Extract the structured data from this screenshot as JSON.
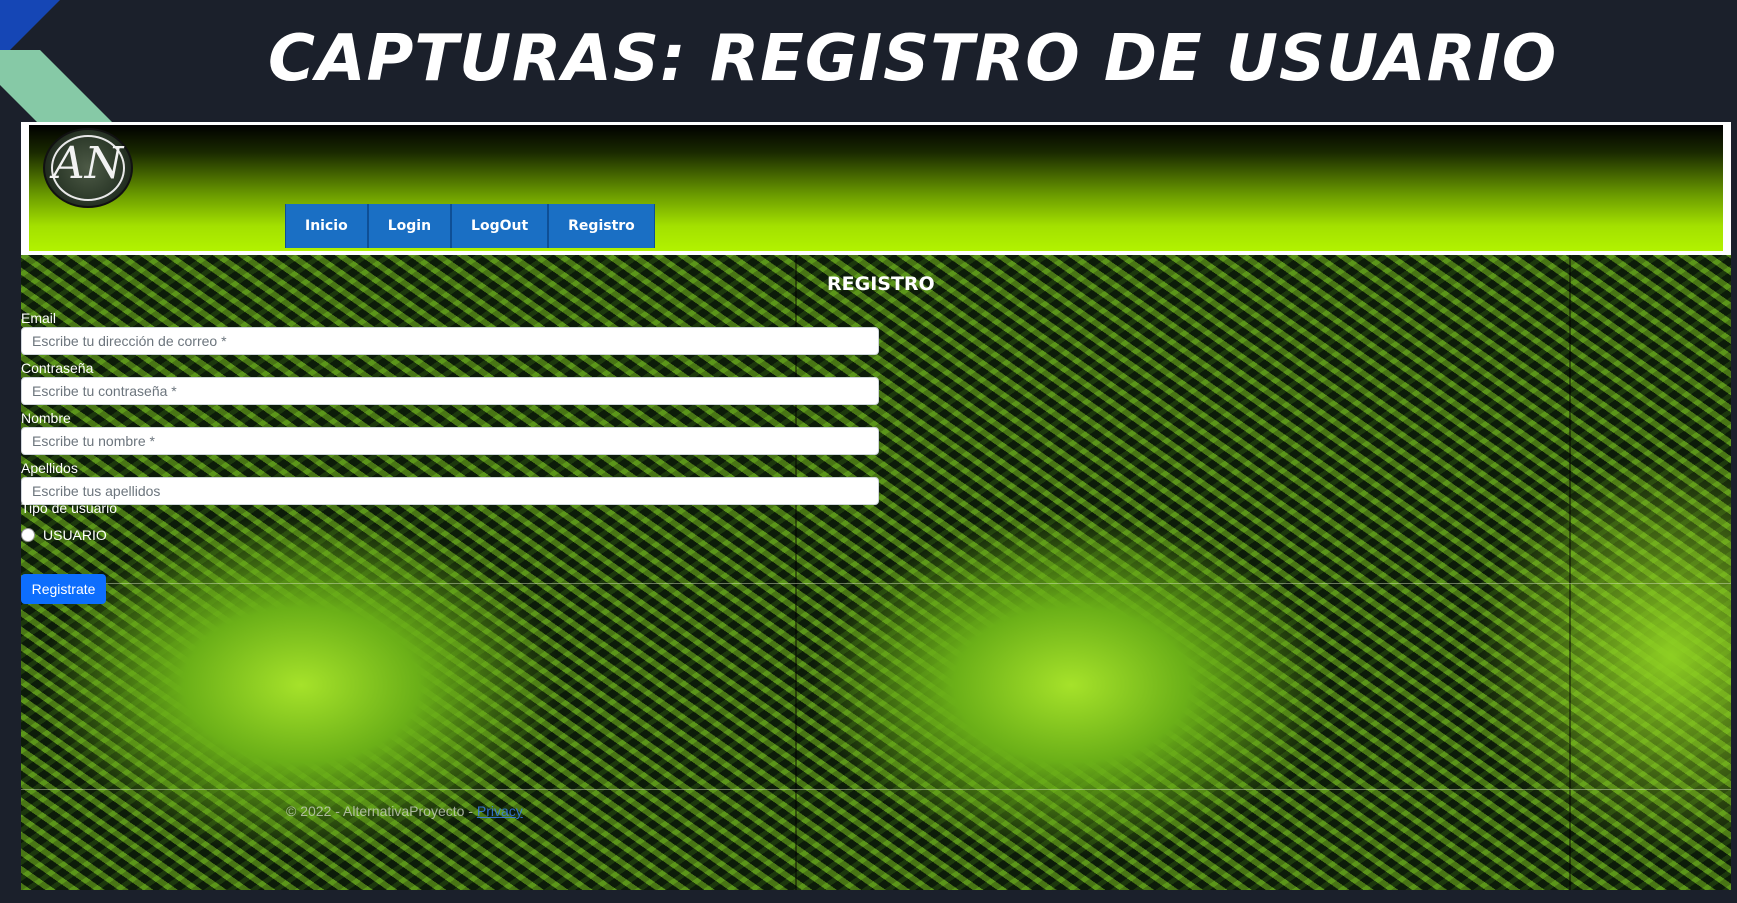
{
  "slide": {
    "title": "CAPTURAS: REGISTRO DE USUARIO"
  },
  "app": {
    "logo_text": "AN",
    "nav": [
      {
        "label": "Inicio"
      },
      {
        "label": "Login"
      },
      {
        "label": "LogOut"
      },
      {
        "label": "Registro"
      }
    ]
  },
  "form": {
    "heading": "REGISTRO",
    "fields": [
      {
        "label": "Email",
        "placeholder": "Escribe tu dirección de correo *",
        "value": ""
      },
      {
        "label": "Contraseña",
        "placeholder": "Escribe tu contraseña *",
        "value": ""
      },
      {
        "label": "Nombre",
        "placeholder": "Escribe tu nombre *",
        "value": ""
      },
      {
        "label": "Apellidos",
        "placeholder": "Escribe tus apellidos",
        "value": ""
      }
    ],
    "user_type_label": "Tipo de usuario",
    "user_type_option": "USUARIO",
    "submit_label": "Registrate"
  },
  "footer": {
    "text": "© 2022 - AlternativaProyecto - ",
    "privacy_link": "Privacy"
  },
  "colors": {
    "page_background": "#1b202b",
    "nav_button": "#1a6fc4",
    "submit_button": "#0d6efd",
    "header_gradient_bottom": "#b2f200"
  }
}
